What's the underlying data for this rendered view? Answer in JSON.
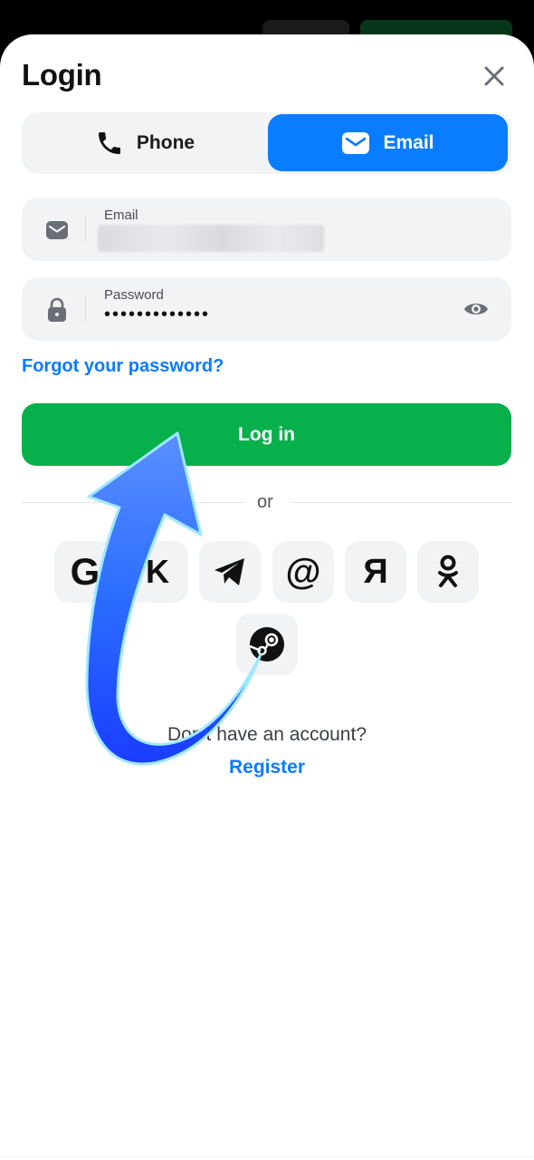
{
  "header": {
    "title": "Login",
    "close_icon": "close-icon"
  },
  "tabs": [
    {
      "label": "Phone",
      "icon": "phone-icon",
      "selected": false
    },
    {
      "label": "Email",
      "icon": "envelope-icon",
      "selected": true
    }
  ],
  "fields": {
    "email": {
      "label": "Email",
      "icon": "envelope-icon",
      "value_obscured": true
    },
    "password": {
      "label": "Password",
      "icon": "lock-icon",
      "value": "•••••••••••••",
      "toggle_icon": "eye-icon"
    }
  },
  "forgot_link": "Forgot your password?",
  "login_button": "Log in",
  "divider_text": "or",
  "social": [
    {
      "name": "google",
      "glyph": "G"
    },
    {
      "name": "vk",
      "glyph": "K"
    },
    {
      "name": "telegram",
      "icon": "telegram-icon"
    },
    {
      "name": "mail",
      "glyph": "@"
    },
    {
      "name": "yandex",
      "glyph": "Я"
    },
    {
      "name": "odnoklassniki",
      "icon": "ok-icon"
    },
    {
      "name": "steam",
      "icon": "steam-icon"
    }
  ],
  "footer": {
    "prompt": "Don't have an account?",
    "register": "Register"
  },
  "colors": {
    "accent_blue": "#0a7cff",
    "login_green": "#07b04b",
    "field_bg": "#f2f3f5",
    "arrow_blue": "#2f6bff"
  }
}
